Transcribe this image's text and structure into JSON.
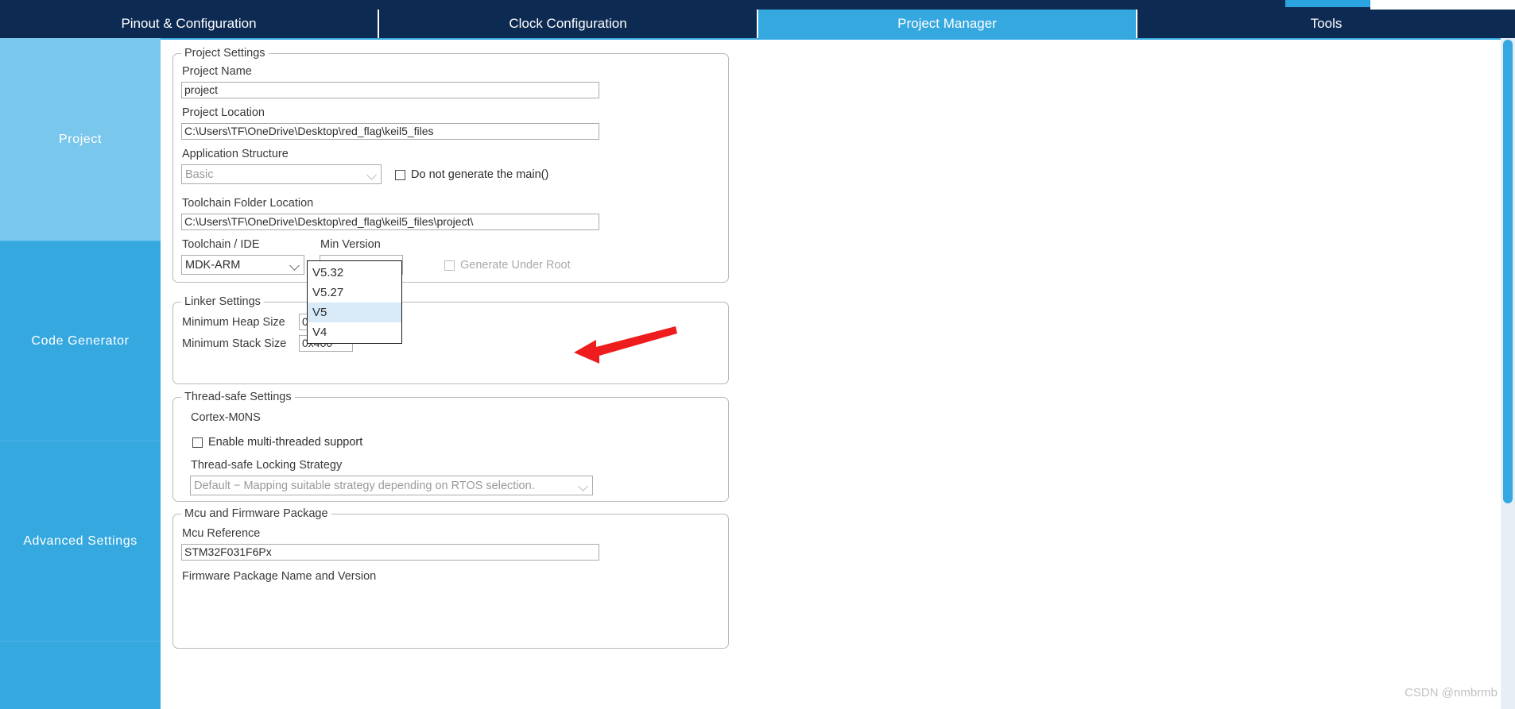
{
  "window": {
    "watermark": "CSDN @nmbrmb"
  },
  "tabs": [
    {
      "label": "Pinout & Configuration",
      "active": false
    },
    {
      "label": "Clock Configuration",
      "active": false
    },
    {
      "label": "Project Manager",
      "active": true
    },
    {
      "label": "Tools",
      "active": false
    }
  ],
  "sidebar": {
    "items": [
      {
        "label": "Project",
        "active": true
      },
      {
        "label": "Code Generator",
        "active": false
      },
      {
        "label": "Advanced Settings",
        "active": false
      },
      {
        "label": "",
        "active": false
      }
    ]
  },
  "project_settings": {
    "group_title": "Project Settings",
    "project_name_label": "Project Name",
    "project_name_value": "project",
    "project_location_label": "Project Location",
    "project_location_value": "C:\\Users\\TF\\OneDrive\\Desktop\\red_flag\\keil5_files",
    "application_structure_label": "Application Structure",
    "application_structure_value": "Basic",
    "do_not_generate_main_label": "Do not generate the main()",
    "do_not_generate_main_checked": false,
    "toolchain_folder_label": "Toolchain Folder Location",
    "toolchain_folder_value": "C:\\Users\\TF\\OneDrive\\Desktop\\red_flag\\keil5_files\\project\\",
    "toolchain_ide_label": "Toolchain / IDE",
    "toolchain_ide_value": "MDK-ARM",
    "min_version_label": "Min Version",
    "min_version_value": "V5",
    "generate_under_root_label": "Generate Under Root",
    "generate_under_root_checked": false
  },
  "min_version_dropdown": {
    "open": true,
    "options": [
      {
        "label": "V5.32",
        "selected": false
      },
      {
        "label": "V5.27",
        "selected": false
      },
      {
        "label": "V5",
        "selected": true
      },
      {
        "label": "V4",
        "selected": false
      }
    ]
  },
  "linker_settings": {
    "group_title": "Linker Settings",
    "heap_label": "Minimum Heap Size",
    "heap_value": "0x200",
    "stack_label": "Minimum Stack Size",
    "stack_value": "0x400"
  },
  "thread_safe_settings": {
    "group_title": "Thread-safe Settings",
    "core_label": "Cortex-M0NS",
    "enable_multithread_label": "Enable multi-threaded support",
    "enable_multithread_checked": false,
    "locking_strategy_label": "Thread-safe Locking Strategy",
    "locking_strategy_value": "Default  −  Mapping suitable strategy depending on RTOS selection."
  },
  "mcu_firmware": {
    "group_title": "Mcu and Firmware Package",
    "mcu_reference_label": "Mcu Reference",
    "mcu_reference_value": "STM32F031F6Px",
    "firmware_package_label": "Firmware Package Name and Version"
  },
  "annotation": {
    "arrow_color": "#ee1c1c"
  }
}
